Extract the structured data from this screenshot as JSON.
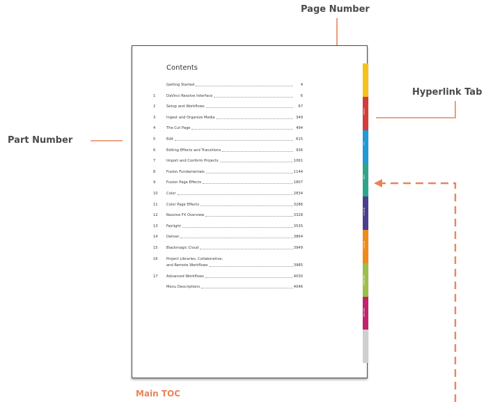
{
  "annotations": {
    "page_number": "Page Number",
    "hyperlink_tab": "Hyperlink Tab",
    "part_number": "Part Number",
    "main_toc": "Main TOC"
  },
  "colors": {
    "accent": "#e8845a",
    "tabs": [
      "#f5c21a",
      "#d63a3a",
      "#1e9ad6",
      "#2ea58a",
      "#4a3f8f",
      "#f08b1a",
      "#9bbf4a",
      "#c4226b",
      "#cfcfcf"
    ]
  },
  "toc": {
    "title": "Contents",
    "entries": [
      {
        "num": "",
        "title": "Getting Started",
        "page": "4"
      },
      {
        "num": "1",
        "title": "DaVinci Resolve Interface",
        "page": "6"
      },
      {
        "num": "2",
        "title": "Setup and Workflows",
        "page": "67"
      },
      {
        "num": "3",
        "title": "Ingest and Organize Media",
        "page": "349"
      },
      {
        "num": "4",
        "title": "The Cut Page",
        "page": "494"
      },
      {
        "num": "5",
        "title": "Edit",
        "page": "615"
      },
      {
        "num": "6",
        "title": "Editing Effects and Transitions",
        "page": "936"
      },
      {
        "num": "7",
        "title": "Import and Conform Projects",
        "page": "1061"
      },
      {
        "num": "8",
        "title": "Fusion Fundamentals",
        "page": "1144"
      },
      {
        "num": "9",
        "title": "Fusion Page Effects",
        "page": "1807"
      },
      {
        "num": "10",
        "title": "Color",
        "page": "2834"
      },
      {
        "num": "11",
        "title": "Color Page Effects",
        "page": "3286"
      },
      {
        "num": "12",
        "title": "Resolve FX Overview",
        "page": "3328"
      },
      {
        "num": "13",
        "title": "Fairlight",
        "page": "3535"
      },
      {
        "num": "14",
        "title": "Deliver",
        "page": "3864"
      },
      {
        "num": "15",
        "title": "Blackmagic Cloud",
        "page": "3949"
      },
      {
        "num": "16",
        "title": "Project Libraries, Collaborative,",
        "title2": "and Remote Workflows",
        "page": "3985"
      },
      {
        "num": "17",
        "title": "Advanced Workflows",
        "page": "4030"
      },
      {
        "num": "",
        "title": "Menu Descriptions",
        "page": "4046"
      }
    ]
  },
  "tabs": [
    "MEDIA",
    "CUT",
    "EDIT",
    "FUSION",
    "COLOR",
    "FAIRLIGHT",
    "DELIVER"
  ]
}
